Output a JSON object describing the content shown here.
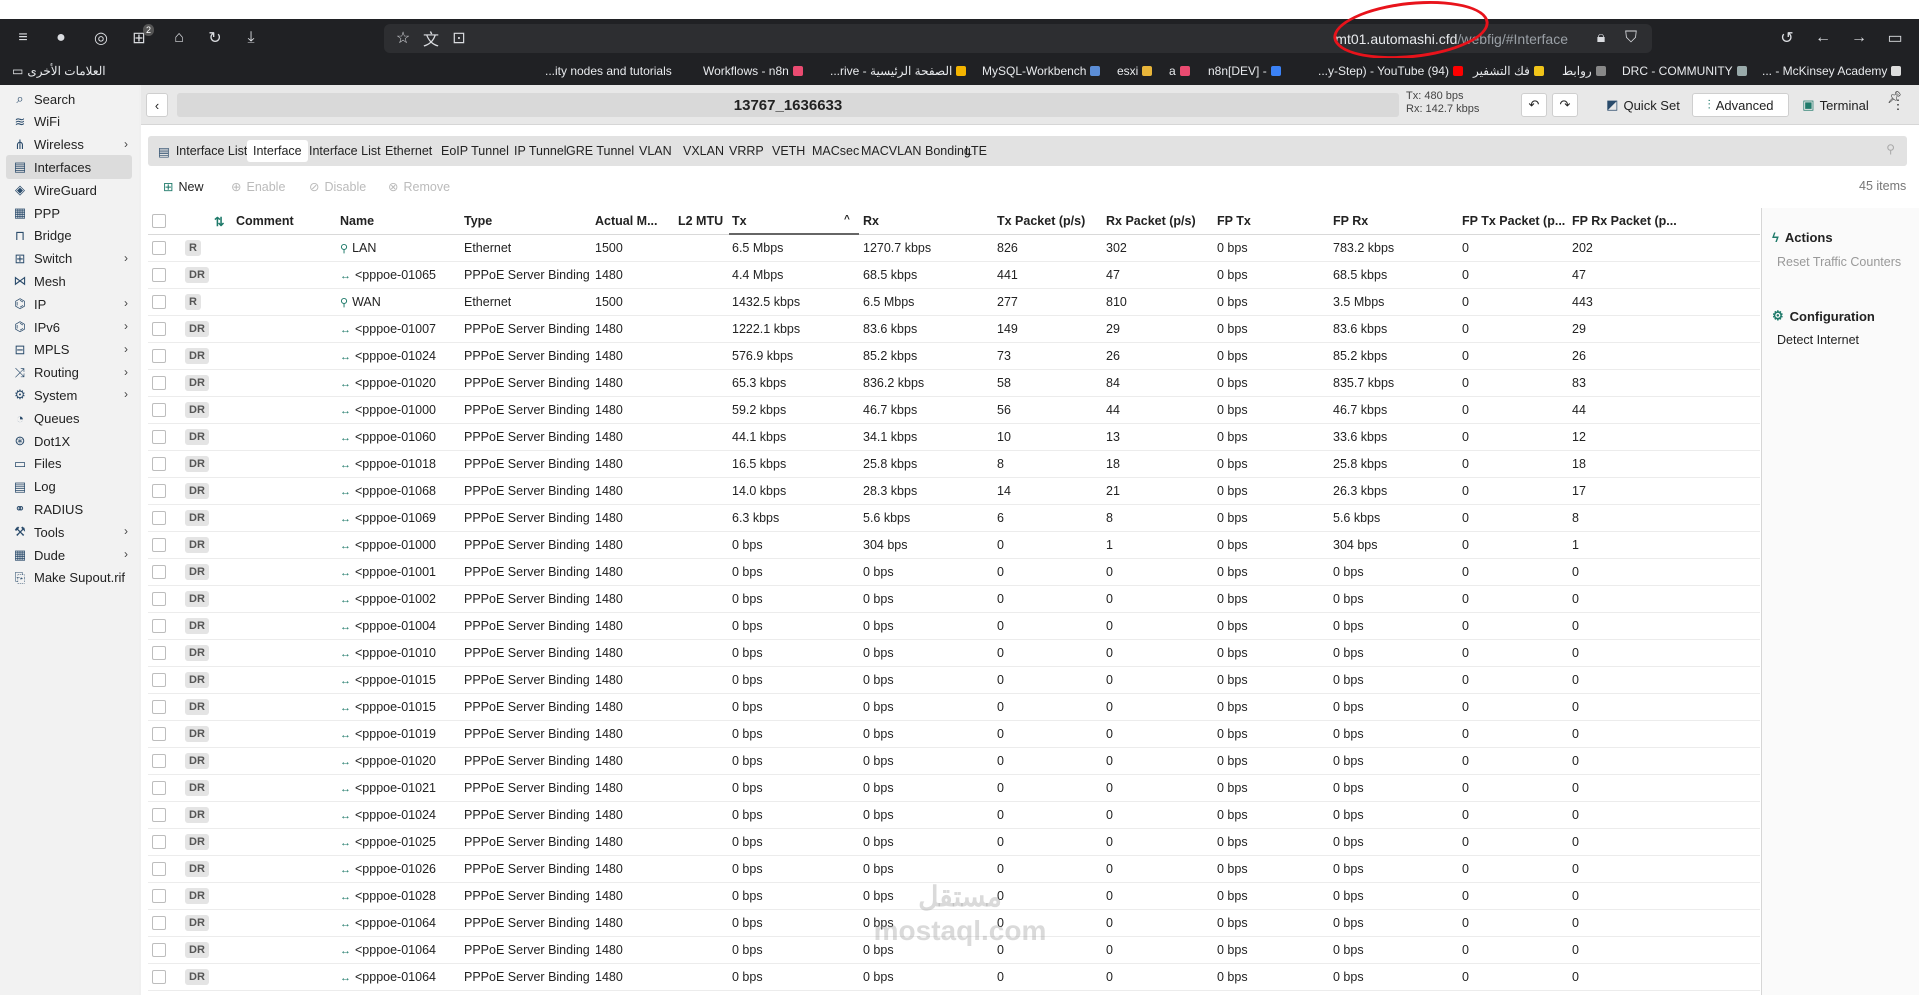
{
  "browser": {
    "url_host_part": "mt01.",
    "url_host": "automashi.cfd",
    "url_path": "/webfig/#Interface",
    "tab_badge_count": "2"
  },
  "bookmarks": [
    {
      "label": "العلامات الأخرى"
    },
    {
      "label": "...ity nodes and tutorials"
    },
    {
      "label": "Workflows - n8n"
    },
    {
      "label": "...rive - الصفحة الرئيسية"
    },
    {
      "label": "MySQL-Workbench"
    },
    {
      "label": "esxi"
    },
    {
      "label": "a"
    },
    {
      "label": "n8n[DEV] -"
    },
    {
      "label": "...y-Step) - YouTube (94)"
    },
    {
      "label": "فك التشفير"
    },
    {
      "label": "روابط"
    },
    {
      "label": "DRC - COMMUNITY"
    },
    {
      "label": "... - McKinsey Academy"
    }
  ],
  "sidebar": {
    "items": [
      {
        "label": "Search",
        "icon": "search-icon",
        "chevron": false
      },
      {
        "label": "WiFi",
        "icon": "wifi-icon",
        "chevron": false
      },
      {
        "label": "Wireless",
        "icon": "wireless-icon",
        "chevron": true
      },
      {
        "label": "Interfaces",
        "icon": "interfaces-icon",
        "chevron": false,
        "active": true
      },
      {
        "label": "WireGuard",
        "icon": "wireguard-icon",
        "chevron": false
      },
      {
        "label": "PPP",
        "icon": "ppp-icon",
        "chevron": false
      },
      {
        "label": "Bridge",
        "icon": "bridge-icon",
        "chevron": false
      },
      {
        "label": "Switch",
        "icon": "switch-icon",
        "chevron": true
      },
      {
        "label": "Mesh",
        "icon": "mesh-icon",
        "chevron": false
      },
      {
        "label": "IP",
        "icon": "ip-icon",
        "chevron": true
      },
      {
        "label": "IPv6",
        "icon": "ipv6-icon",
        "chevron": true
      },
      {
        "label": "MPLS",
        "icon": "mpls-icon",
        "chevron": true
      },
      {
        "label": "Routing",
        "icon": "routing-icon",
        "chevron": true
      },
      {
        "label": "System",
        "icon": "system-icon",
        "chevron": true
      },
      {
        "label": "Queues",
        "icon": "queues-icon",
        "chevron": false
      },
      {
        "label": "Dot1X",
        "icon": "dot1x-icon",
        "chevron": false
      },
      {
        "label": "Files",
        "icon": "files-icon",
        "chevron": false
      },
      {
        "label": "Log",
        "icon": "log-icon",
        "chevron": false
      },
      {
        "label": "RADIUS",
        "icon": "radius-icon",
        "chevron": false
      },
      {
        "label": "Tools",
        "icon": "tools-icon",
        "chevron": true
      },
      {
        "label": "Dude",
        "icon": "dude-icon",
        "chevron": true
      },
      {
        "label": "Make Supout.rif",
        "icon": "supout-icon",
        "chevron": false
      }
    ]
  },
  "header": {
    "title": "13767_1636633",
    "tx_rate": "Tx: 480 bps",
    "rx_rate": "Rx: 142.7 kbps",
    "quick_set": "Quick Set",
    "advanced": "Advanced",
    "terminal": "Terminal"
  },
  "tabs": [
    {
      "label": "Interface List",
      "first": true
    },
    {
      "label": "Interface",
      "active": true
    },
    {
      "label": "Interface List"
    },
    {
      "label": "Ethernet"
    },
    {
      "label": "EoIP Tunnel"
    },
    {
      "label": "IP Tunnel"
    },
    {
      "label": "GRE Tunnel"
    },
    {
      "label": "VLAN"
    },
    {
      "label": "VXLAN"
    },
    {
      "label": "VRRP"
    },
    {
      "label": "VETH"
    },
    {
      "label": "MACsec"
    },
    {
      "label": "MACVLAN"
    },
    {
      "label": "Bonding"
    },
    {
      "label": "LTE"
    }
  ],
  "toolbar": {
    "new": "New",
    "enable": "Enable",
    "disable": "Disable",
    "remove": "Remove",
    "item_count": "45 items"
  },
  "table": {
    "columns": [
      "Comment",
      "Name",
      "Type",
      "Actual M...",
      "L2 MTU",
      "Tx",
      "Rx",
      "Tx Packet (p/s)",
      "Rx Packet (p/s)",
      "FP Tx",
      "FP Rx",
      "FP Tx Packet (p...",
      "FP Rx Packet (p..."
    ],
    "sort_indicator": "^",
    "rows": [
      {
        "flag": "R",
        "name": "LAN",
        "type": "Ethernet",
        "mtu": "1500",
        "tx": "6.5 Mbps",
        "rx": "1270.7 kbps",
        "txp": "826",
        "rxp": "302",
        "fptx": "0 bps",
        "fprx": "783.2 kbps",
        "fptxp": "0",
        "fprxp": "202"
      },
      {
        "flag": "DR",
        "name": "<pppoe-01065...",
        "type": "PPPoE Server Binding",
        "mtu": "1480",
        "tx": "4.4 Mbps",
        "rx": "68.5 kbps",
        "txp": "441",
        "rxp": "47",
        "fptx": "0 bps",
        "fprx": "68.5 kbps",
        "fptxp": "0",
        "fprxp": "47"
      },
      {
        "flag": "R",
        "name": "WAN",
        "type": "Ethernet",
        "mtu": "1500",
        "tx": "1432.5 kbps",
        "rx": "6.5 Mbps",
        "txp": "277",
        "rxp": "810",
        "fptx": "0 bps",
        "fprx": "3.5 Mbps",
        "fptxp": "0",
        "fprxp": "443"
      },
      {
        "flag": "DR",
        "name": "<pppoe-010071...",
        "type": "PPPoE Server Binding",
        "mtu": "1480",
        "tx": "1222.1 kbps",
        "rx": "83.6 kbps",
        "txp": "149",
        "rxp": "29",
        "fptx": "0 bps",
        "fprx": "83.6 kbps",
        "fptxp": "0",
        "fprxp": "29"
      },
      {
        "flag": "DR",
        "name": "<pppoe-01024...",
        "type": "PPPoE Server Binding",
        "mtu": "1480",
        "tx": "576.9 kbps",
        "rx": "85.2 kbps",
        "txp": "73",
        "rxp": "26",
        "fptx": "0 bps",
        "fprx": "85.2 kbps",
        "fptxp": "0",
        "fprxp": "26"
      },
      {
        "flag": "DR",
        "name": "<pppoe-01020...",
        "type": "PPPoE Server Binding",
        "mtu": "1480",
        "tx": "65.3 kbps",
        "rx": "836.2 kbps",
        "txp": "58",
        "rxp": "84",
        "fptx": "0 bps",
        "fprx": "835.7 kbps",
        "fptxp": "0",
        "fprxp": "83"
      },
      {
        "flag": "DR",
        "name": "<pppoe-01000...",
        "type": "PPPoE Server Binding",
        "mtu": "1480",
        "tx": "59.2 kbps",
        "rx": "46.7 kbps",
        "txp": "56",
        "rxp": "44",
        "fptx": "0 bps",
        "fprx": "46.7 kbps",
        "fptxp": "0",
        "fprxp": "44"
      },
      {
        "flag": "DR",
        "name": "<pppoe-01060...",
        "type": "PPPoE Server Binding",
        "mtu": "1480",
        "tx": "44.1 kbps",
        "rx": "34.1 kbps",
        "txp": "10",
        "rxp": "13",
        "fptx": "0 bps",
        "fprx": "33.6 kbps",
        "fptxp": "0",
        "fprxp": "12"
      },
      {
        "flag": "DR",
        "name": "<pppoe-01018...",
        "type": "PPPoE Server Binding",
        "mtu": "1480",
        "tx": "16.5 kbps",
        "rx": "25.8 kbps",
        "txp": "8",
        "rxp": "18",
        "fptx": "0 bps",
        "fprx": "25.8 kbps",
        "fptxp": "0",
        "fprxp": "18"
      },
      {
        "flag": "DR",
        "name": "<pppoe-01068...",
        "type": "PPPoE Server Binding",
        "mtu": "1480",
        "tx": "14.0 kbps",
        "rx": "28.3 kbps",
        "txp": "14",
        "rxp": "21",
        "fptx": "0 bps",
        "fprx": "26.3 kbps",
        "fptxp": "0",
        "fprxp": "17"
      },
      {
        "flag": "DR",
        "name": "<pppoe-01069...",
        "type": "PPPoE Server Binding",
        "mtu": "1480",
        "tx": "6.3 kbps",
        "rx": "5.6 kbps",
        "txp": "6",
        "rxp": "8",
        "fptx": "0 bps",
        "fprx": "5.6 kbps",
        "fptxp": "0",
        "fprxp": "8"
      },
      {
        "flag": "DR",
        "name": "<pppoe-01000...",
        "type": "PPPoE Server Binding",
        "mtu": "1480",
        "tx": "0 bps",
        "rx": "304 bps",
        "txp": "0",
        "rxp": "1",
        "fptx": "0 bps",
        "fprx": "304 bps",
        "fptxp": "0",
        "fprxp": "1"
      },
      {
        "flag": "DR",
        "name": "<pppoe-01001...",
        "type": "PPPoE Server Binding",
        "mtu": "1480",
        "tx": "0 bps",
        "rx": "0 bps",
        "txp": "0",
        "rxp": "0",
        "fptx": "0 bps",
        "fprx": "0 bps",
        "fptxp": "0",
        "fprxp": "0"
      },
      {
        "flag": "DR",
        "name": "<pppoe-01002...",
        "type": "PPPoE Server Binding",
        "mtu": "1480",
        "tx": "0 bps",
        "rx": "0 bps",
        "txp": "0",
        "rxp": "0",
        "fptx": "0 bps",
        "fprx": "0 bps",
        "fptxp": "0",
        "fprxp": "0"
      },
      {
        "flag": "DR",
        "name": "<pppoe-01004...",
        "type": "PPPoE Server Binding",
        "mtu": "1480",
        "tx": "0 bps",
        "rx": "0 bps",
        "txp": "0",
        "rxp": "0",
        "fptx": "0 bps",
        "fprx": "0 bps",
        "fptxp": "0",
        "fprxp": "0"
      },
      {
        "flag": "DR",
        "name": "<pppoe-01010...",
        "type": "PPPoE Server Binding",
        "mtu": "1480",
        "tx": "0 bps",
        "rx": "0 bps",
        "txp": "0",
        "rxp": "0",
        "fptx": "0 bps",
        "fprx": "0 bps",
        "fptxp": "0",
        "fprxp": "0"
      },
      {
        "flag": "DR",
        "name": "<pppoe-01015...",
        "type": "PPPoE Server Binding",
        "mtu": "1480",
        "tx": "0 bps",
        "rx": "0 bps",
        "txp": "0",
        "rxp": "0",
        "fptx": "0 bps",
        "fprx": "0 bps",
        "fptxp": "0",
        "fprxp": "0"
      },
      {
        "flag": "DR",
        "name": "<pppoe-01015...",
        "type": "PPPoE Server Binding",
        "mtu": "1480",
        "tx": "0 bps",
        "rx": "0 bps",
        "txp": "0",
        "rxp": "0",
        "fptx": "0 bps",
        "fprx": "0 bps",
        "fptxp": "0",
        "fprxp": "0"
      },
      {
        "flag": "DR",
        "name": "<pppoe-01019...",
        "type": "PPPoE Server Binding",
        "mtu": "1480",
        "tx": "0 bps",
        "rx": "0 bps",
        "txp": "0",
        "rxp": "0",
        "fptx": "0 bps",
        "fprx": "0 bps",
        "fptxp": "0",
        "fprxp": "0"
      },
      {
        "flag": "DR",
        "name": "<pppoe-01020...",
        "type": "PPPoE Server Binding",
        "mtu": "1480",
        "tx": "0 bps",
        "rx": "0 bps",
        "txp": "0",
        "rxp": "0",
        "fptx": "0 bps",
        "fprx": "0 bps",
        "fptxp": "0",
        "fprxp": "0"
      },
      {
        "flag": "DR",
        "name": "<pppoe-01021...",
        "type": "PPPoE Server Binding",
        "mtu": "1480",
        "tx": "0 bps",
        "rx": "0 bps",
        "txp": "0",
        "rxp": "0",
        "fptx": "0 bps",
        "fprx": "0 bps",
        "fptxp": "0",
        "fprxp": "0"
      },
      {
        "flag": "DR",
        "name": "<pppoe-01024...",
        "type": "PPPoE Server Binding",
        "mtu": "1480",
        "tx": "0 bps",
        "rx": "0 bps",
        "txp": "0",
        "rxp": "0",
        "fptx": "0 bps",
        "fprx": "0 bps",
        "fptxp": "0",
        "fprxp": "0"
      },
      {
        "flag": "DR",
        "name": "<pppoe-01025...",
        "type": "PPPoE Server Binding",
        "mtu": "1480",
        "tx": "0 bps",
        "rx": "0 bps",
        "txp": "0",
        "rxp": "0",
        "fptx": "0 bps",
        "fprx": "0 bps",
        "fptxp": "0",
        "fprxp": "0"
      },
      {
        "flag": "DR",
        "name": "<pppoe-01026...",
        "type": "PPPoE Server Binding",
        "mtu": "1480",
        "tx": "0 bps",
        "rx": "0 bps",
        "txp": "0",
        "rxp": "0",
        "fptx": "0 bps",
        "fprx": "0 bps",
        "fptxp": "0",
        "fprxp": "0"
      },
      {
        "flag": "DR",
        "name": "<pppoe-01028...",
        "type": "PPPoE Server Binding",
        "mtu": "1480",
        "tx": "0 bps",
        "rx": "0 bps",
        "txp": "0",
        "rxp": "0",
        "fptx": "0 bps",
        "fprx": "0 bps",
        "fptxp": "0",
        "fprxp": "0"
      },
      {
        "flag": "DR",
        "name": "<pppoe-01064...",
        "type": "PPPoE Server Binding",
        "mtu": "1480",
        "tx": "0 bps",
        "rx": "0 bps",
        "txp": "0",
        "rxp": "0",
        "fptx": "0 bps",
        "fprx": "0 bps",
        "fptxp": "0",
        "fprxp": "0"
      },
      {
        "flag": "DR",
        "name": "<pppoe-01064...",
        "type": "PPPoE Server Binding",
        "mtu": "1480",
        "tx": "0 bps",
        "rx": "0 bps",
        "txp": "0",
        "rxp": "0",
        "fptx": "0 bps",
        "fprx": "0 bps",
        "fptxp": "0",
        "fprxp": "0"
      },
      {
        "flag": "DR",
        "name": "<pppoe-01064...",
        "type": "PPPoE Server Binding",
        "mtu": "1480",
        "tx": "0 bps",
        "rx": "0 bps",
        "txp": "0",
        "rxp": "0",
        "fptx": "0 bps",
        "fprx": "0 bps",
        "fptxp": "0",
        "fprxp": "0"
      }
    ]
  },
  "right_panel": {
    "actions_title": "Actions",
    "reset_traffic": "Reset Traffic Counters",
    "configuration_title": "Configuration",
    "detect_internet": "Detect Internet"
  },
  "watermark": {
    "line1": "مستقل",
    "line2": "mostaql.com"
  }
}
